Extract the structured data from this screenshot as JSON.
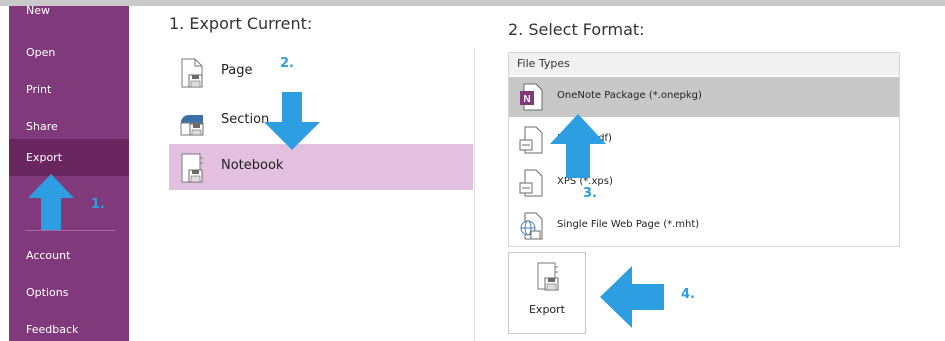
{
  "sidebar": {
    "items": [
      {
        "label": "New"
      },
      {
        "label": "Open"
      },
      {
        "label": "Print"
      },
      {
        "label": "Share"
      },
      {
        "label": "Export"
      },
      {
        "label": "Account"
      },
      {
        "label": "Options"
      },
      {
        "label": "Feedback"
      }
    ]
  },
  "export_current": {
    "title": "1. Export Current:",
    "options": [
      {
        "label": "Page",
        "icon": "page-icon"
      },
      {
        "label": "Section",
        "icon": "section-icon"
      },
      {
        "label": "Notebook",
        "icon": "notebook-icon"
      }
    ],
    "selected": "Notebook"
  },
  "select_format": {
    "title": "2. Select Format:",
    "header": "File Types",
    "types": [
      {
        "label": "OneNote Package (*.onepkg)",
        "icon": "onenote-package-icon"
      },
      {
        "label": "PDF (*.pdf)",
        "icon": "pdf-icon"
      },
      {
        "label": "XPS (*.xps)",
        "icon": "xps-icon"
      },
      {
        "label": "Single File Web Page (*.mht)",
        "icon": "web-page-icon"
      }
    ],
    "selected": "OneNote Package (*.onepkg)"
  },
  "export_button": {
    "label": "Export",
    "icon": "export-icon"
  },
  "annotations": {
    "step1": "1.",
    "step2": "2.",
    "step3": "3.",
    "step4": "4."
  },
  "colors": {
    "sidebar": "#80397b",
    "sidebar_selected": "#69265f",
    "option_selected": "#e3c0df",
    "filetype_selected": "#c8c8c8",
    "arrow": "#2e9ee3"
  }
}
